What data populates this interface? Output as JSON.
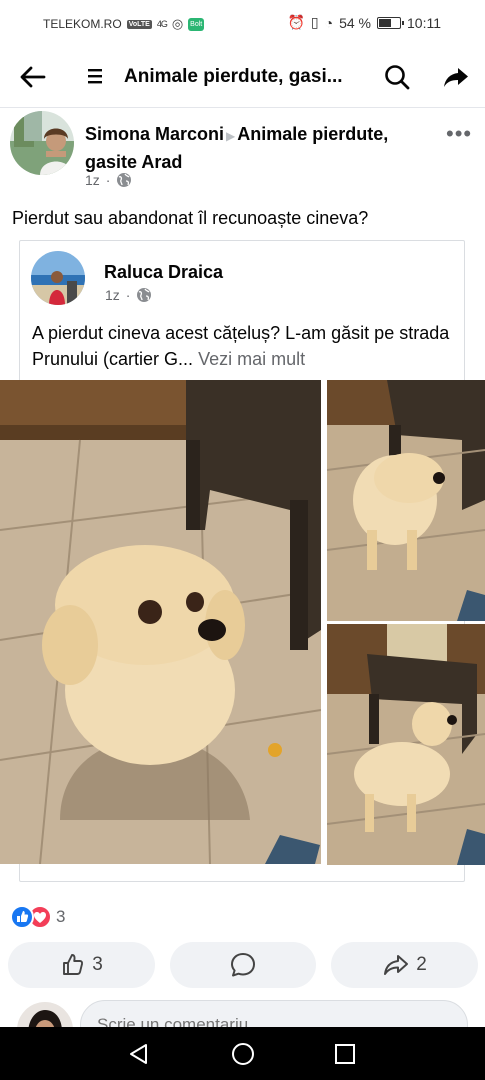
{
  "status_bar": {
    "carrier": "TELEKOM.RO",
    "volte_badge": "VoLTE",
    "network": "4G",
    "battery_percent": "54 %",
    "battery_level": 0.54,
    "time": "10:11"
  },
  "app_bar": {
    "back_icon": "arrow-left-icon",
    "menu_icon": "list-icon",
    "title": "Animale pierdute, gasi...",
    "search_icon": "search-icon",
    "share_icon": "share-icon"
  },
  "post": {
    "author": "Simona Marconi",
    "group": "Animale pierdute, gasite Arad",
    "time": "1z",
    "more_label": "•••",
    "text": "Pierdut sau abandonat îl recunoaște cineva?"
  },
  "shared_post": {
    "author": "Raluca Draica",
    "time": "1z",
    "text": "A pierdut cineva acest cățeluș? L-am găsit pe strada Prunului (cartier G...",
    "see_more": "Vezi mai mult"
  },
  "reactions": {
    "count": "3"
  },
  "actions": {
    "like_count": "3",
    "share_count": "2"
  },
  "comment_composer": {
    "placeholder": "Scrie un comentariu..."
  },
  "colors": {
    "brand": "#1877f2",
    "love": "#f33e58",
    "secondary_text": "#65676b"
  }
}
